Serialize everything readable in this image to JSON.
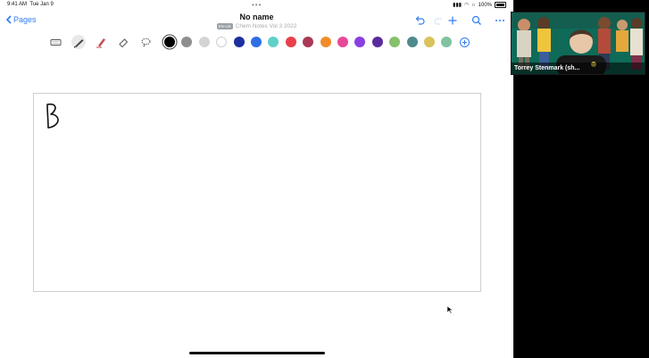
{
  "status": {
    "time": "9:41 AM",
    "date": "Tue Jan 9",
    "battery": "100%"
  },
  "nav": {
    "back_label": "Pages"
  },
  "header": {
    "title": "No name",
    "tag": "EN-US",
    "notebook": "Chem Notes Vol 3 2022"
  },
  "icons": {
    "back": "chevron-left-icon",
    "undo": "undo-icon",
    "add": "plus-icon",
    "search": "search-icon",
    "more": "ellipsis-icon",
    "tools": [
      "keyboard-icon",
      "pen-icon",
      "highlighter-icon",
      "eraser-icon",
      "lasso-icon"
    ],
    "add_color": "add-color-icon"
  },
  "colors": [
    "#000000",
    "#8e8e8e",
    "#d4d4d4",
    "#ffffff",
    "#1c2f9c",
    "#2f6ee6",
    "#5fd0c8",
    "#e8404a",
    "#a83a55",
    "#f28c28",
    "#e8489a",
    "#8a3fe0",
    "#5a2a9e",
    "#86c06c",
    "#4f8a8c",
    "#d8c45a",
    "#7fc3a0"
  ],
  "selected_color": "#000000",
  "canvas": {
    "handwriting": "B"
  },
  "video": {
    "participant_name": "Torrey Stenmark (sh..."
  }
}
